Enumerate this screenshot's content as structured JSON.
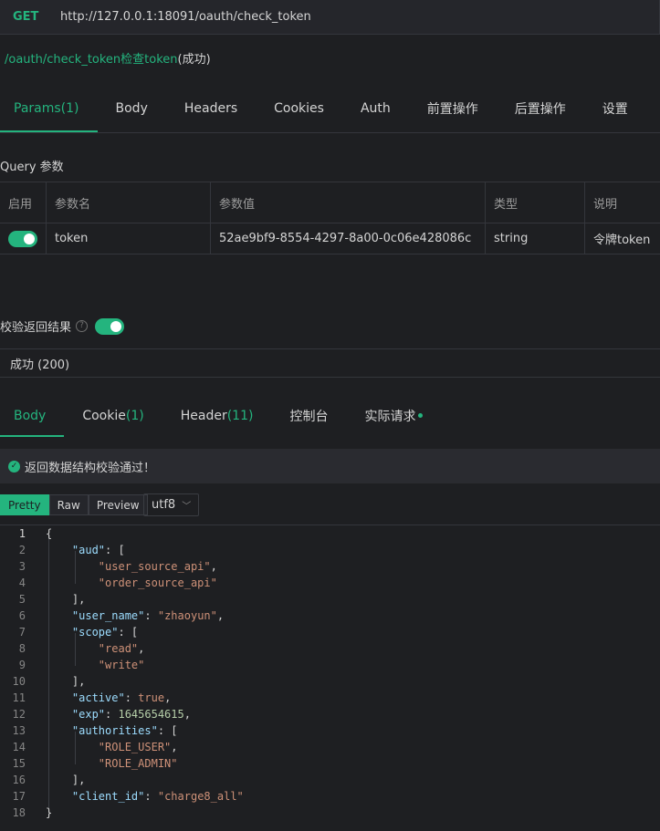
{
  "request": {
    "method": "GET",
    "url": "http://127.0.0.1:18091/oauth/check_token",
    "path": "/oauth/check_token检查token",
    "status": "(成功)"
  },
  "tabs": [
    {
      "label": "Params",
      "count": " (1)"
    },
    {
      "label": "Body"
    },
    {
      "label": "Headers"
    },
    {
      "label": "Cookies"
    },
    {
      "label": "Auth"
    },
    {
      "label": "前置操作"
    },
    {
      "label": "后置操作"
    },
    {
      "label": "设置"
    }
  ],
  "query": {
    "title": "Query 参数",
    "headers": [
      "启用",
      "参数名",
      "参数值",
      "类型",
      "说明"
    ],
    "rows": [
      {
        "name": "token",
        "value": "52ae9bf9-8554-4297-8a00-0c06e428086c",
        "type": "string",
        "desc": "令牌token"
      }
    ]
  },
  "verify": {
    "label": "校验返回结果",
    "status": "成功 (200)"
  },
  "response_tabs": [
    {
      "label": "Body"
    },
    {
      "label": "Cookie",
      "count": " (1)"
    },
    {
      "label": "Header",
      "count": " (11)"
    },
    {
      "label": "控制台"
    },
    {
      "label": "实际请求"
    }
  ],
  "validation_message": "返回数据结构校验通过！",
  "view_modes": [
    "Pretty",
    "Raw",
    "Preview"
  ],
  "encoding": "utf8",
  "line_numbers": [
    "1",
    "2",
    "3",
    "4",
    "5",
    "6",
    "7",
    "8",
    "9",
    "10",
    "11",
    "12",
    "13",
    "14",
    "15",
    "16",
    "17",
    "18"
  ],
  "json": {
    "aud_key": "\"aud\"",
    "aud_1": "\"user_source_api\"",
    "aud_2": "\"order_source_api\"",
    "user_name_key": "\"user_name\"",
    "user_name": "\"zhaoyun\"",
    "scope_key": "\"scope\"",
    "scope_1": "\"read\"",
    "scope_2": "\"write\"",
    "active_key": "\"active\"",
    "active": "true",
    "exp_key": "\"exp\"",
    "exp": "1645654615",
    "authorities_key": "\"authorities\"",
    "auth_1": "\"ROLE_USER\"",
    "auth_2": "\"ROLE_ADMIN\"",
    "client_id_key": "\"client_id\"",
    "client_id": "\"charge8_all\""
  },
  "colors": {
    "accent": "#24b47e",
    "background": "#1e1f22"
  }
}
